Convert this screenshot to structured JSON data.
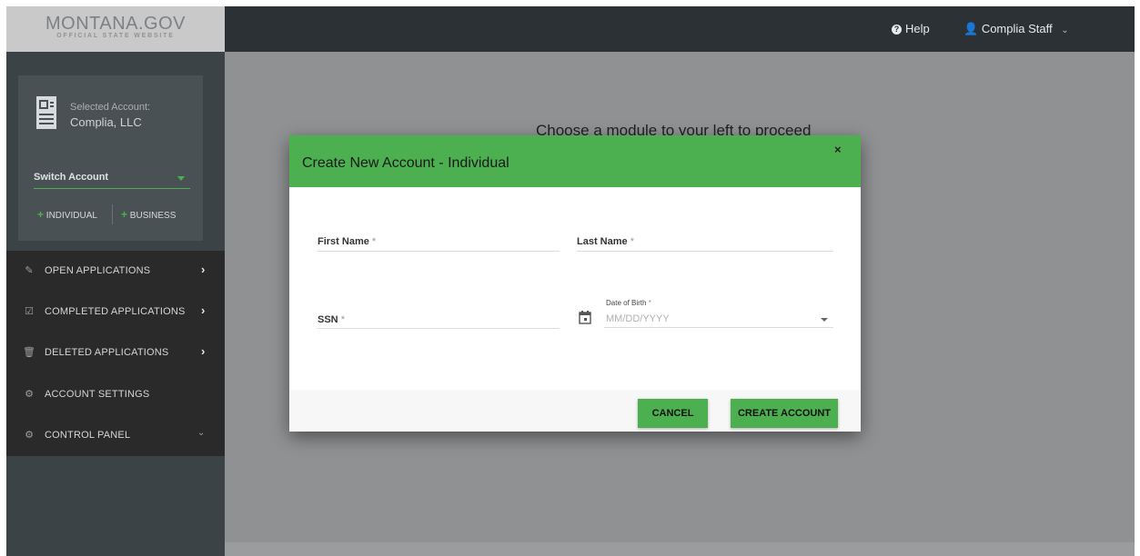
{
  "brand": {
    "logo_main": "MONTANA.GOV",
    "logo_sub": "OFFICIAL STATE WEBSITE"
  },
  "account": {
    "selected_label": "Selected Account:",
    "selected_name": "Complia, LLC",
    "switch_label": "Switch Account",
    "add_individual": "INDIVIDUAL",
    "add_business": "BUSINESS"
  },
  "nav": {
    "items": [
      {
        "label": "OPEN APPLICATIONS",
        "icon": "edit-icon"
      },
      {
        "label": "COMPLETED APPLICATIONS",
        "icon": "checkbox-icon"
      },
      {
        "label": "DELETED APPLICATIONS",
        "icon": "trash-icon"
      },
      {
        "label": "ACCOUNT SETTINGS",
        "icon": "gear-icon"
      },
      {
        "label": "CONTROL PANEL",
        "icon": "cogs-icon"
      }
    ]
  },
  "topbar": {
    "help_label": "Help",
    "user_label": "Complia Staff"
  },
  "main": {
    "message": "Choose a module to your left to proceed"
  },
  "modal": {
    "title": "Create New Account - Individual",
    "close_glyph": "×",
    "first_name_label": "First Name",
    "last_name_label": "Last Name",
    "ssn_label": "SSN",
    "required_marker": "*",
    "dob_label": "Date of Birth",
    "dob_placeholder": "MM/DD/YYYY",
    "cancel_label": "CANCEL",
    "create_label": "CREATE ACCOUNT"
  },
  "colors": {
    "accent": "#4caf50",
    "sidebar": "#3b4347",
    "nav_bg": "#2a2a2a",
    "topbar": "#2b3135",
    "overlay": "#8f9192"
  }
}
